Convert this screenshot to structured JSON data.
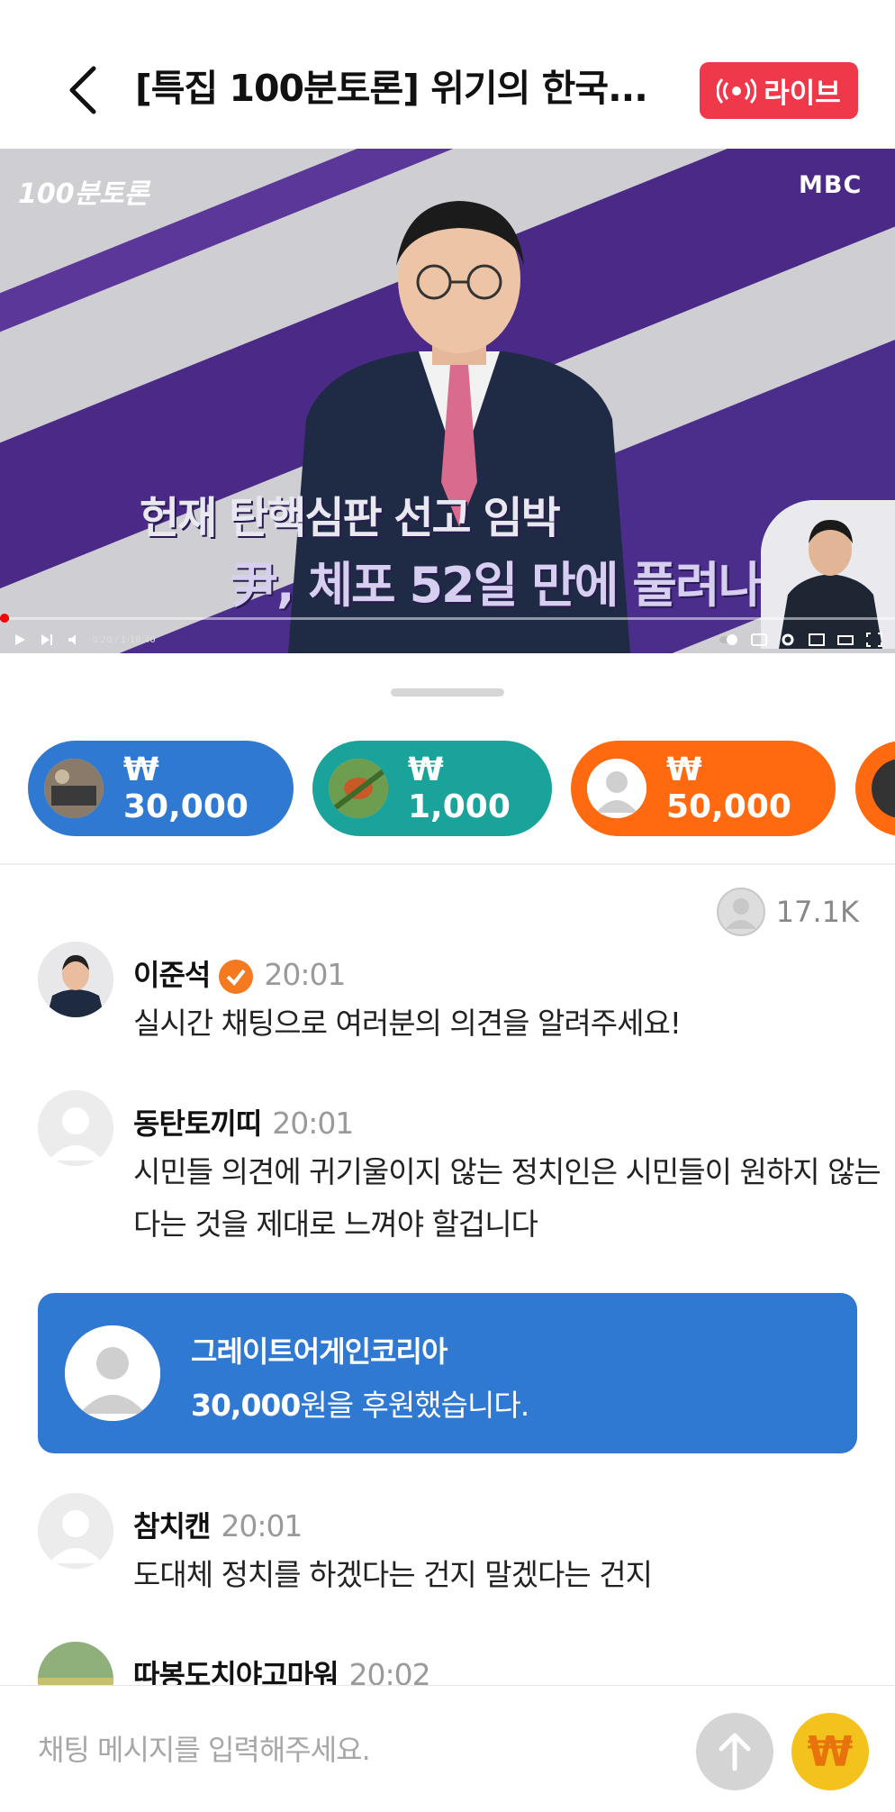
{
  "header": {
    "title": "[특집 100분토론] 위기의 한국...",
    "live_label": "라이브"
  },
  "video": {
    "logo": "100분토론",
    "channel": "MBC",
    "caption_line1": "헌재 탄핵심판 선고 임박",
    "caption_line2": "尹, 체포 52일 만에 풀려나",
    "time_text": "0:20 / 1:18:40"
  },
  "donation_pills": [
    {
      "amount": "₩ 30,000",
      "color": "#2f79d2"
    },
    {
      "amount": "₩ 1,000",
      "color": "#1aa39a"
    },
    {
      "amount": "₩ 50,000",
      "color": "#ff6a10"
    }
  ],
  "viewers": "17.1K",
  "messages": [
    {
      "name": "이준석",
      "time": "20:01",
      "text": "실시간 채팅으로 여러분의 의견을 알려주세요!",
      "verified": true
    },
    {
      "name": "동탄토끼띠",
      "time": "20:01",
      "text": "시민들 의견에 귀기울이지 않는 정치인은 시민들이 원하지 않는다는 것을 제대로 느껴야 할겁니다"
    },
    {
      "name": "참치캔",
      "time": "20:01",
      "text": "도대체 정치를 하겠다는 건지 말겠다는 건지"
    },
    {
      "name": "따봉도치야고마워",
      "time": "20:02",
      "text": ""
    }
  ],
  "donation_card": {
    "name": "그레이트어게인코리아",
    "amount": "30,000",
    "suffix": "원을 후원했습니다."
  },
  "input": {
    "placeholder": "채팅 메시지를 입력해주세요."
  },
  "colors": {
    "live": "#f0384b",
    "donation_blue": "#2f79d2",
    "verified": "#f57a1f",
    "won_button": "#f4c21c"
  }
}
